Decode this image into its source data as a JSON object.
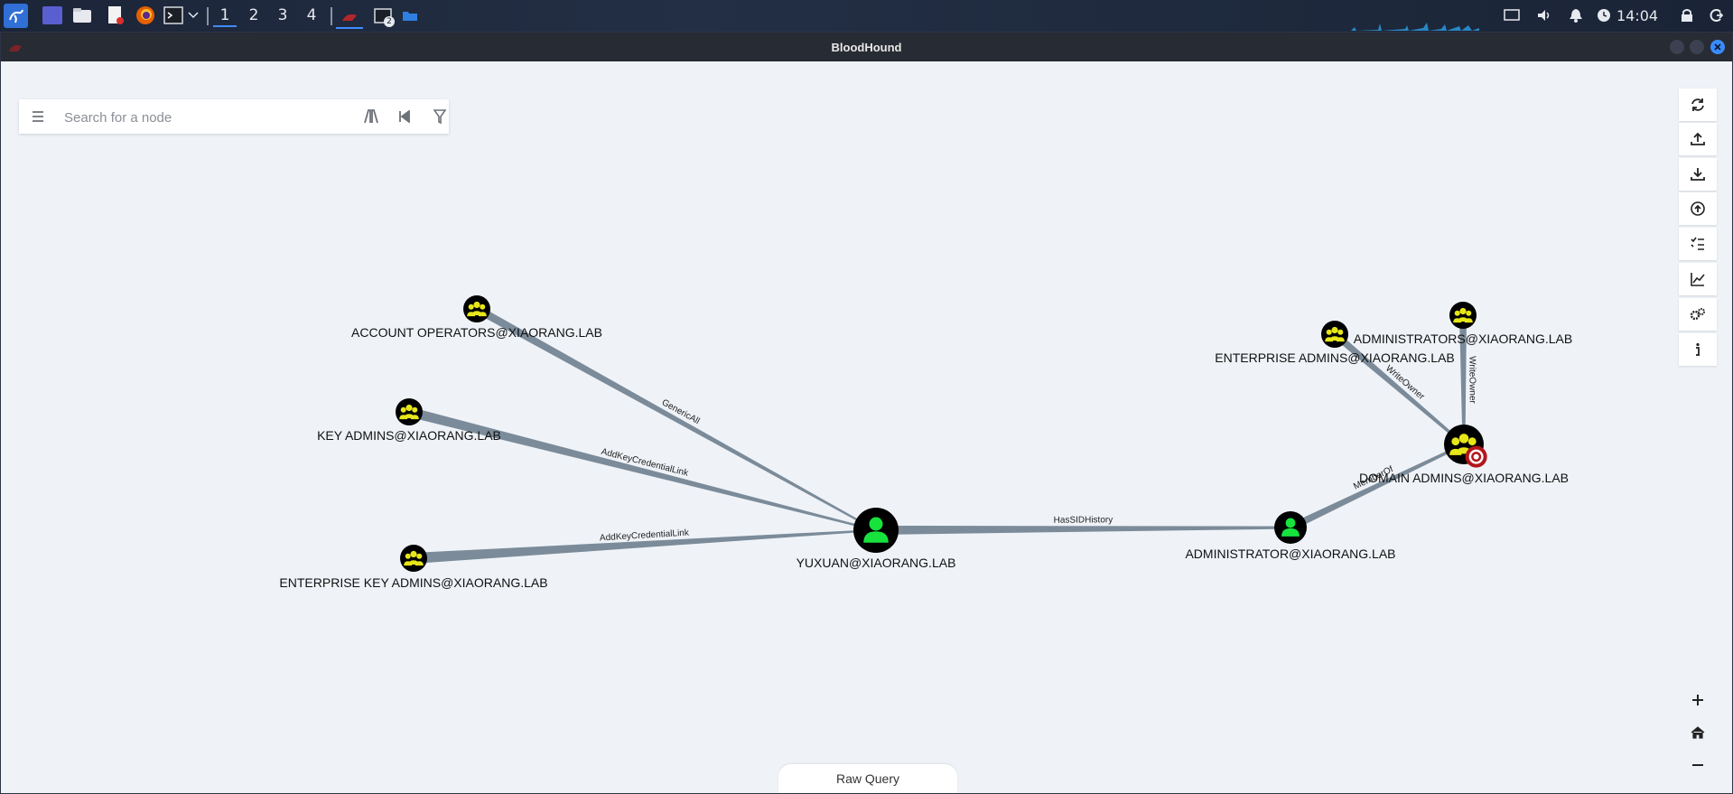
{
  "taskbar": {
    "workspaces": [
      "1",
      "2",
      "3",
      "4"
    ],
    "active_workspace": "1",
    "terminal_badge": "2",
    "clock": "14:04"
  },
  "window": {
    "title": "BloodHound",
    "accent_colors": {
      "close": "#3a8bff",
      "edge": "#7b8b99",
      "user_node": "#17e33d",
      "group_node": "#e6e619",
      "target_badge": "#b3151c"
    }
  },
  "search": {
    "placeholder": "Search for a node"
  },
  "toolbar": {
    "tools": [
      "refresh-icon",
      "export-icon",
      "import-icon",
      "upload-icon",
      "tasks-icon",
      "graph-stats-icon",
      "settings-icon",
      "info-icon"
    ],
    "zoom": [
      "zoom-in-icon",
      "home-icon",
      "zoom-out-icon"
    ]
  },
  "graph": {
    "nodes": [
      {
        "id": "account_operators",
        "type": "group",
        "label": "ACCOUNT OPERATORS@XIAORANG.LAB"
      },
      {
        "id": "key_admins",
        "type": "group",
        "label": "KEY ADMINS@XIAORANG.LAB"
      },
      {
        "id": "enterprise_key_admins",
        "type": "group",
        "label": "ENTERPRISE KEY ADMINS@XIAORANG.LAB"
      },
      {
        "id": "yuxuan",
        "type": "user",
        "label": "YUXUAN@XIAORANG.LAB"
      },
      {
        "id": "administrator",
        "type": "user",
        "label": "ADMINISTRATOR@XIAORANG.LAB"
      },
      {
        "id": "enterprise_admins",
        "type": "group",
        "label": "ENTERPRISE ADMINS@XIAORANG.LAB"
      },
      {
        "id": "administrators",
        "type": "group",
        "label": "ADMINISTRATORS@XIAORANG.LAB"
      },
      {
        "id": "domain_admins",
        "type": "group",
        "label": "DOMAIN ADMINS@XIAORANG.LAB",
        "highvalue": true
      }
    ],
    "edges": [
      {
        "from": "yuxuan",
        "to": "account_operators",
        "label": "GenericAll"
      },
      {
        "from": "yuxuan",
        "to": "key_admins",
        "label": "AddKeyCredentialLink"
      },
      {
        "from": "yuxuan",
        "to": "enterprise_key_admins",
        "label": "AddKeyCredentialLink"
      },
      {
        "from": "yuxuan",
        "to": "administrator",
        "label": "HasSIDHistory"
      },
      {
        "from": "administrator",
        "to": "domain_admins",
        "label": "MemberOf"
      },
      {
        "from": "enterprise_admins",
        "to": "domain_admins",
        "label": "WriteOwner"
      },
      {
        "from": "administrators",
        "to": "domain_admins",
        "label": "WriteOwner"
      }
    ]
  },
  "raw_query": {
    "label": "Raw Query"
  }
}
